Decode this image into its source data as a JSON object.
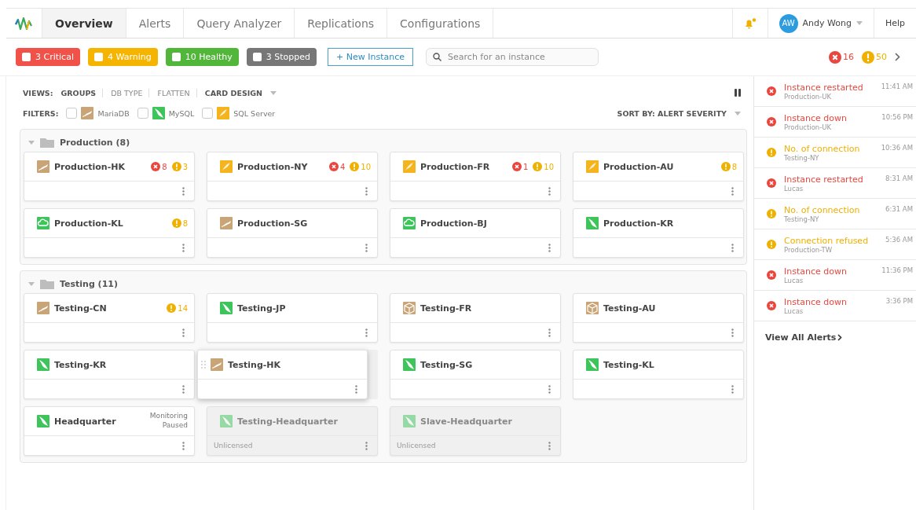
{
  "nav": {
    "tabs": [
      {
        "label": "Overview",
        "selected": true
      },
      {
        "label": "Alerts",
        "selected": false
      },
      {
        "label": "Query Analyzer",
        "selected": false
      },
      {
        "label": "Replications",
        "selected": false
      },
      {
        "label": "Configurations",
        "selected": false
      }
    ],
    "notification_dot": true,
    "user": {
      "initials": "AW",
      "name": "Andy Wong"
    },
    "help": "Help"
  },
  "toolbar": {
    "statuses": [
      {
        "label": "3 Critical",
        "color": "#f0524a"
      },
      {
        "label": "4 Warning",
        "color": "#f4b400"
      },
      {
        "label": "10 Healthy",
        "color": "#52b63a"
      },
      {
        "label": "3 Stopped",
        "color": "#777777"
      }
    ],
    "new_button": "+ New Instance",
    "search": {
      "placeholder": "Search for an instance"
    },
    "error_count": "16",
    "warning_count": "50"
  },
  "views": {
    "label": "VIEWS:",
    "items": [
      {
        "label": "GROUPS",
        "selected": true
      },
      {
        "label": "DB TYPE",
        "selected": false
      },
      {
        "label": "FLATTEN",
        "selected": false
      }
    ],
    "design": "CARD DESIGN"
  },
  "filters": {
    "label": "FILTERS:",
    "items": [
      {
        "label": "MariaDB",
        "kind": "mariadb",
        "checked": false
      },
      {
        "label": "MySQL",
        "kind": "mysql",
        "checked": false
      },
      {
        "label": "SQL Server",
        "kind": "sqlserver",
        "checked": false
      }
    ],
    "sort": "SORT BY: ALERT SEVERITY"
  },
  "groups": [
    {
      "title": "Production (8)",
      "expanded": true,
      "cards": [
        {
          "kind": "mariadb",
          "name": "Production-HK",
          "errors": "8",
          "warnings": "3"
        },
        {
          "kind": "sqlserver",
          "name": "Production-NY",
          "errors": "4",
          "warnings": "10"
        },
        {
          "kind": "sqlserver",
          "name": "Production-FR",
          "errors": "1",
          "warnings": "10"
        },
        {
          "kind": "sqlserver",
          "name": "Production-AU",
          "warnings": "8"
        },
        {
          "kind": "cloud",
          "name": "Production-KL",
          "warnings": "8"
        },
        {
          "kind": "mariadb",
          "name": "Production-SG"
        },
        {
          "kind": "cloud",
          "name": "Production-BJ"
        },
        {
          "kind": "mysql",
          "name": "Production-KR"
        }
      ]
    },
    {
      "title": "Testing (11)",
      "expanded": true,
      "cards": [
        {
          "kind": "mariadb",
          "name": "Testing-CN",
          "warnings": "14"
        },
        {
          "kind": "mysql",
          "name": "Testing-JP"
        },
        {
          "kind": "box",
          "name": "Testing-FR"
        },
        {
          "kind": "box",
          "name": "Testing-AU"
        },
        {
          "kind": "mysql",
          "name": "Testing-KR"
        },
        {
          "kind": "placeholder"
        },
        {
          "kind": "mysql",
          "name": "Testing-SG"
        },
        {
          "kind": "mysql",
          "name": "Testing-KL"
        },
        {
          "kind": "mysql",
          "name": "Headquarter",
          "note": "Monitoring Paused"
        },
        {
          "kind": "mysql",
          "name": "Testing-Headquarter",
          "disabled": true,
          "footer": "Unlicensed"
        },
        {
          "kind": "mysql",
          "name": "Slave-Headquarter",
          "disabled": true,
          "footer": "Unlicensed"
        }
      ],
      "dragging": {
        "name": "Testing-HK",
        "kind": "mariadb"
      }
    }
  ],
  "alerts": {
    "items": [
      {
        "kind": "error",
        "title": "Instance restarted",
        "source": "Production-UK",
        "time": "11:41 AM"
      },
      {
        "kind": "error",
        "title": "Instance down",
        "source": "Production-UK",
        "time": "10:56 PM"
      },
      {
        "kind": "warning",
        "title": "No. of connection",
        "source": "Testing-NY",
        "time": "10:36 AM"
      },
      {
        "kind": "error",
        "title": "Instance restarted",
        "source": "Lucas",
        "time": "8:31 AM"
      },
      {
        "kind": "warning",
        "title": "No. of connection",
        "source": "Testing-NY",
        "time": "6:31 AM"
      },
      {
        "kind": "warning",
        "title": "Connection refused",
        "source": "Production-TW",
        "time": "5:36 AM"
      },
      {
        "kind": "error",
        "title": "Instance down",
        "source": "Lucas",
        "time": "11:36 PM"
      },
      {
        "kind": "error",
        "title": "Instance down",
        "source": "Lucas",
        "time": "3:36 PM"
      }
    ],
    "view_all": "View All Alerts"
  }
}
